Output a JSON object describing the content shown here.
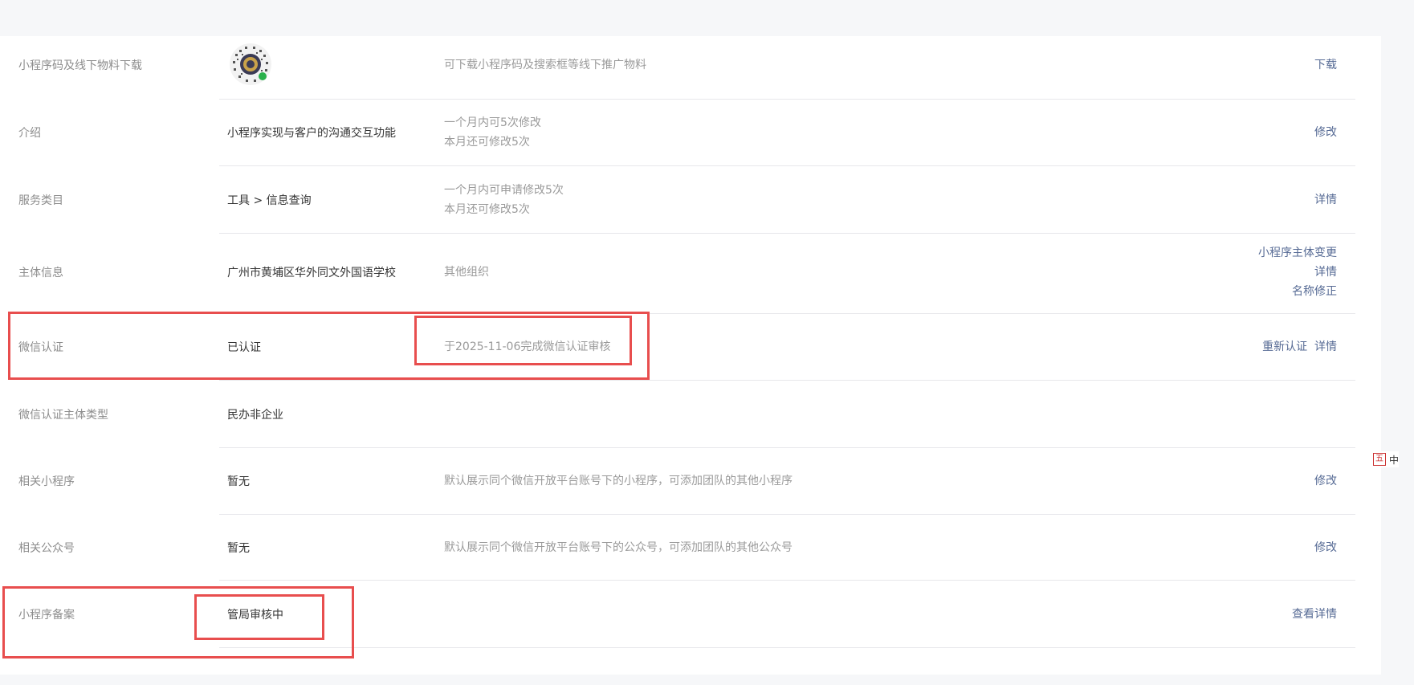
{
  "rows": [
    {
      "label": "小程序码及线下物料下载",
      "desc": "可下载小程序码及搜索框等线下推广物料",
      "action": "下载",
      "qr_icon": "qr-code-icon"
    },
    {
      "label": "介绍",
      "value": "小程序实现与客户的沟通交互功能",
      "desc_lines": [
        "一个月内可5次修改",
        "本月还可修改5次"
      ],
      "action": "修改"
    },
    {
      "label": "服务类目",
      "value": "工具 > 信息查询",
      "desc_lines": [
        "一个月内可申请修改5次",
        "本月还可修改5次"
      ],
      "action": "详情"
    },
    {
      "label": "主体信息",
      "value": "广州市黄埔区华外同文外国语学校",
      "desc": "其他组织",
      "actions": [
        "小程序主体变更",
        "详情",
        "名称修正"
      ]
    },
    {
      "label": "微信认证",
      "value": "已认证",
      "desc": "于2025-11-06完成微信认证审核",
      "actions": [
        "重新认证",
        "详情"
      ]
    },
    {
      "label": "微信认证主体类型",
      "value": "民办非企业"
    },
    {
      "label": "相关小程序",
      "value": "暂无",
      "desc": "默认展示同个微信开放平台账号下的小程序，可添加团队的其他小程序",
      "action": "修改"
    },
    {
      "label": "相关公众号",
      "value": "暂无",
      "desc": "默认展示同个微信开放平台账号下的公众号，可添加团队的其他公众号",
      "action": "修改"
    },
    {
      "label": "小程序备案",
      "value": "管局审核中",
      "action": "查看详情"
    }
  ],
  "ime": {
    "icon": "ime-icon",
    "text": "中"
  },
  "colors": {
    "link": "#576b95",
    "highlight": "#e84e4e",
    "label": "#8d8d8d",
    "value": "#353535",
    "desc": "#9a9a9a"
  }
}
